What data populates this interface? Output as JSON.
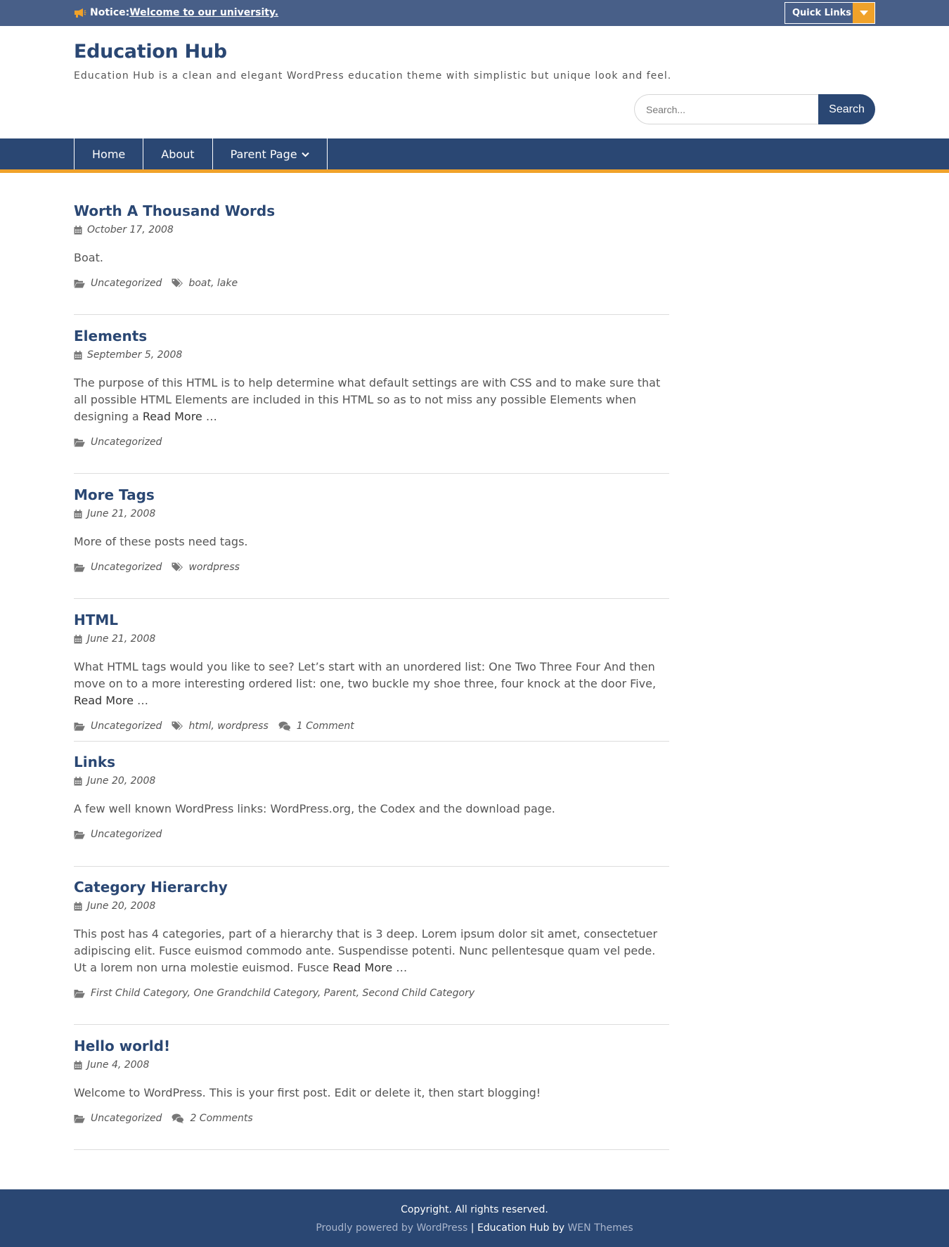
{
  "topbar": {
    "notice_label": "Notice:",
    "notice_link": "Welcome to our university.",
    "quick_links": "Quick Links"
  },
  "header": {
    "title": "Education Hub",
    "description": "Education Hub is a clean and elegant WordPress education theme with simplistic but unique look and feel."
  },
  "search": {
    "placeholder": "Search...",
    "button": "Search"
  },
  "nav": {
    "items": [
      {
        "label": "Home"
      },
      {
        "label": "About"
      },
      {
        "label": "Parent Page"
      }
    ]
  },
  "posts": [
    {
      "title": "Worth A Thousand Words",
      "date": "October 17, 2008",
      "excerpt": "Boat.",
      "read_more": "",
      "categories": "Uncategorized",
      "tags": [
        "boat",
        "lake"
      ],
      "comments": ""
    },
    {
      "title": "Elements",
      "date": "September 5, 2008",
      "excerpt": "The purpose of this HTML is to help determine what default settings are with CSS and to make sure that all possible HTML Elements are included in this HTML so as to not miss any possible Elements when designing a",
      "read_more": "Read More",
      "categories": "Uncategorized",
      "tags": [],
      "comments": ""
    },
    {
      "title": "More Tags",
      "date": "June 21, 2008",
      "excerpt": "More of these posts need tags.",
      "read_more": "",
      "categories": "Uncategorized",
      "tags": [
        "wordpress"
      ],
      "comments": ""
    },
    {
      "title": "HTML",
      "date": "June 21, 2008",
      "excerpt": "What HTML tags would you like to see? Let’s start with an unordered list: One Two Three Four And then move on to a more interesting ordered list: one, two buckle my shoe three, four knock at the door Five,",
      "read_more": "Read More",
      "categories": "Uncategorized",
      "tags": [
        "html",
        "wordpress"
      ],
      "comments": "1 Comment"
    },
    {
      "title": "Links",
      "date": "June 20, 2008",
      "excerpt": "A few well known WordPress links: WordPress.org, the Codex and the download page.",
      "read_more": "",
      "categories": "Uncategorized",
      "tags": [],
      "comments": ""
    },
    {
      "title": "Category Hierarchy",
      "date": "June 20, 2008",
      "excerpt": "This post has 4 categories, part of a hierarchy that is 3 deep. Lorem ipsum dolor sit amet, consectetuer adipiscing elit. Fusce euismod commodo ante. Suspendisse potenti. Nunc pellentesque quam vel pede. Ut a lorem non urna molestie euismod. Fusce",
      "read_more": "Read More",
      "categories": "First Child Category, One Grandchild Category, Parent, Second Child Category",
      "tags": [],
      "comments": ""
    },
    {
      "title": "Hello world!",
      "date": "June 4, 2008",
      "excerpt": "Welcome to WordPress. This is your first post. Edit or delete it, then start blogging!",
      "read_more": "",
      "categories": "Uncategorized",
      "tags": [],
      "comments": "2 Comments"
    }
  ],
  "footer": {
    "copyright": "Copyright. All rights reserved.",
    "powered_by": "Proudly powered by WordPress",
    "separator": "|",
    "theme_name": "Education Hub by",
    "theme_author": "WEN Themes"
  },
  "colors": {
    "primary": "#2a4773",
    "topbar": "#485f88",
    "accent": "#f0a22a"
  }
}
